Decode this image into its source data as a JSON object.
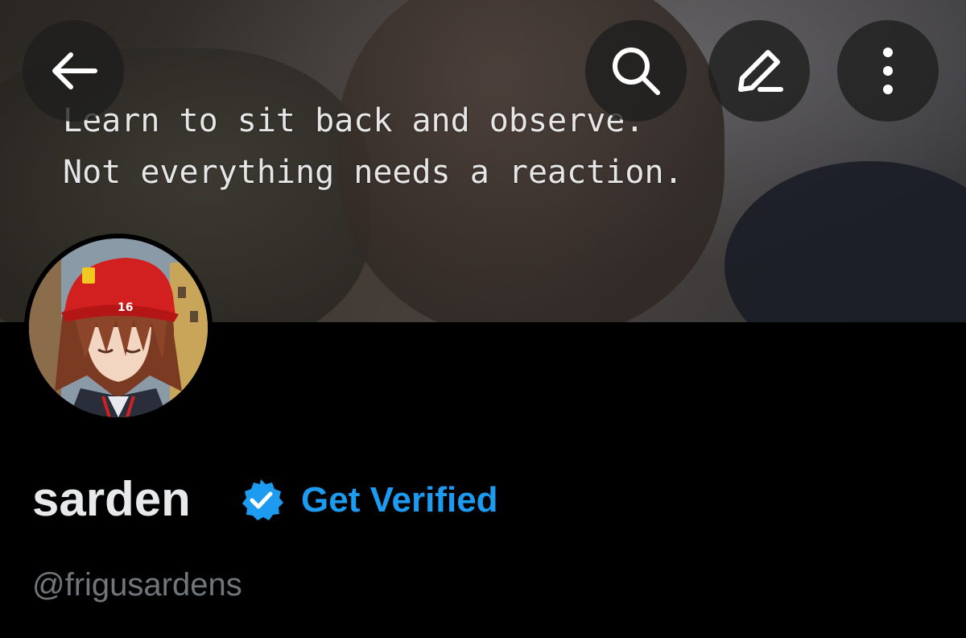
{
  "banner": {
    "quote_line1": "Learn to sit back and observe.",
    "quote_line2": "Not everything needs a reaction."
  },
  "toolbar": {
    "back_icon": "arrow-left-icon",
    "search_icon": "search-icon",
    "edit_icon": "pencil-icon",
    "more_icon": "more-vertical-icon"
  },
  "profile": {
    "display_name": "sarden",
    "badge_icon": "verified-badge-icon",
    "get_verified_label": "Get Verified",
    "handle": "@frigusardens",
    "avatar_cap_number": "16"
  },
  "colors": {
    "background": "#000000",
    "accent": "#1d9bf0",
    "name_text": "#e7e9ea",
    "handle_text": "#71767b"
  }
}
